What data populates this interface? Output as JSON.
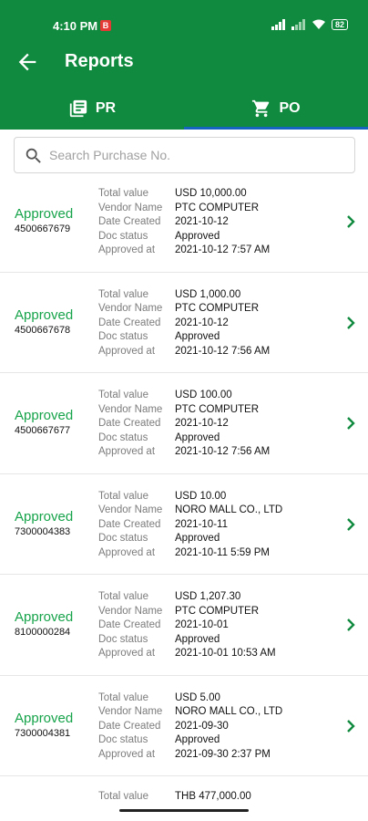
{
  "status_bar": {
    "time": "4:10 PM",
    "notification_badge": "B",
    "battery": "82"
  },
  "app_bar": {
    "title": "Reports",
    "back_icon": "arrow-left-icon"
  },
  "tabs": [
    {
      "label": "PR",
      "icon": "document-list-icon",
      "active": false
    },
    {
      "label": "PO",
      "icon": "shopping-cart-icon",
      "active": true
    }
  ],
  "search": {
    "placeholder": "Search Purchase No.",
    "value": ""
  },
  "labels": {
    "total_value": "Total value",
    "vendor_name": "Vendor Name",
    "date_created": "Date Created",
    "doc_status": "Doc status",
    "approved_at": "Approved at"
  },
  "orders": [
    {
      "status": "Approved",
      "po_number": "4500667679",
      "total_value": "USD 10,000.00",
      "vendor_name": "PTC COMPUTER",
      "date_created": "2021-10-12",
      "doc_status": "Approved",
      "approved_at": "2021-10-12 7:57 AM"
    },
    {
      "status": "Approved",
      "po_number": "4500667678",
      "total_value": "USD 1,000.00",
      "vendor_name": "PTC COMPUTER",
      "date_created": "2021-10-12",
      "doc_status": "Approved",
      "approved_at": "2021-10-12 7:56 AM"
    },
    {
      "status": "Approved",
      "po_number": "4500667677",
      "total_value": "USD 100.00",
      "vendor_name": "PTC COMPUTER",
      "date_created": "2021-10-12",
      "doc_status": "Approved",
      "approved_at": "2021-10-12 7:56 AM"
    },
    {
      "status": "Approved",
      "po_number": "7300004383",
      "total_value": "USD 10.00",
      "vendor_name": "NORO MALL CO., LTD",
      "date_created": "2021-10-11",
      "doc_status": "Approved",
      "approved_at": "2021-10-11 5:59 PM"
    },
    {
      "status": "Approved",
      "po_number": "8100000284",
      "total_value": "USD 1,207.30",
      "vendor_name": "PTC COMPUTER",
      "date_created": "2021-10-01",
      "doc_status": "Approved",
      "approved_at": "2021-10-01 10:53 AM"
    },
    {
      "status": "Approved",
      "po_number": "7300004381",
      "total_value": "USD 5.00",
      "vendor_name": "NORO MALL CO., LTD",
      "date_created": "2021-09-30",
      "doc_status": "Approved",
      "approved_at": "2021-09-30 2:37 PM"
    }
  ],
  "partial_order": {
    "total_value": "THB 477,000.00"
  },
  "colors": {
    "header_green": "#0f8a3e",
    "approved_green": "#16a34a",
    "tab_indicator": "#1565c0"
  }
}
